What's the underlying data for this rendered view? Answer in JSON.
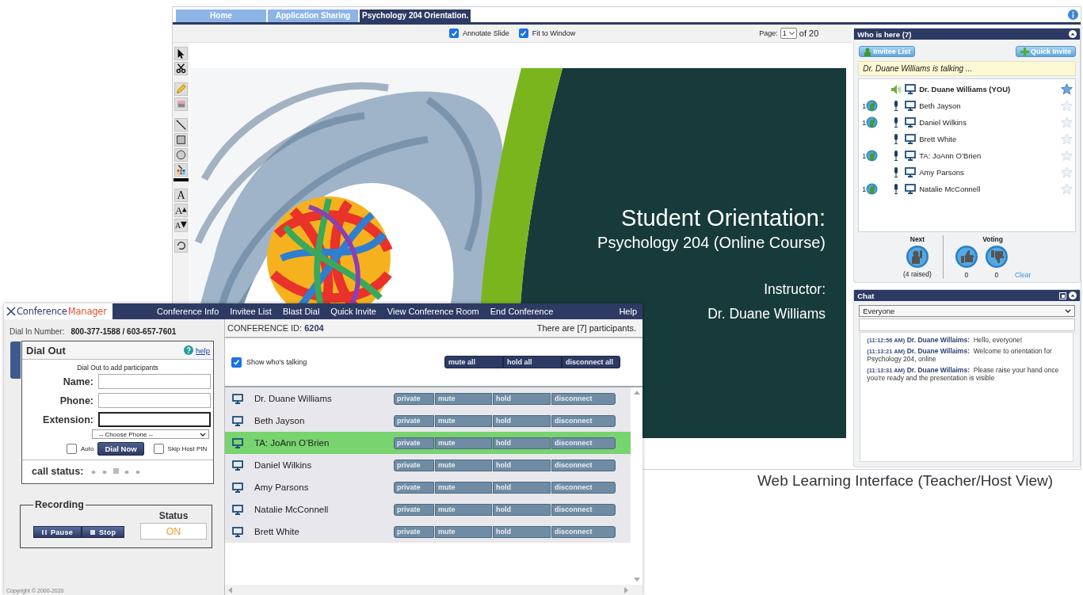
{
  "learning_window": {
    "tabs": [
      {
        "label": "Home",
        "selected": false
      },
      {
        "label": "Application Sharing",
        "selected": false
      },
      {
        "label": "Psychology 204 Orientation.",
        "selected": true
      }
    ],
    "options": [
      {
        "label": "Annotate Slide",
        "checked": true
      },
      {
        "label": "Fit to Window",
        "checked": true
      }
    ],
    "page": {
      "label": "Page:",
      "value": "1",
      "total": "of 20"
    },
    "tools": [
      {
        "kind": "pointer"
      },
      {
        "kind": "scissors"
      },
      {
        "kind": "pencil"
      },
      {
        "kind": "eraser"
      },
      {
        "kind": "line"
      },
      {
        "kind": "rectangle"
      },
      {
        "kind": "ellipse"
      },
      {
        "kind": "color"
      },
      {
        "kind": "text",
        "glyph": "A"
      },
      {
        "kind": "text-larger",
        "glyph": "A"
      },
      {
        "kind": "text-smaller",
        "glyph": "A"
      },
      {
        "kind": "rotate"
      }
    ],
    "slide": {
      "title": "Student Orientation:",
      "subtitle": "Psychology 204 (Online Course)",
      "instructor_label": "Instructor:",
      "instructor_name": "Dr. Duane Williams"
    },
    "who_is_here": {
      "title": "Who is here (7)",
      "buttons": [
        {
          "kind": "invitees",
          "label": "Invitee List"
        },
        {
          "kind": "invite",
          "label": "Quick Invite"
        }
      ],
      "talking": "Dr. Duane Williams is talking ...",
      "participants": [
        {
          "name": "Dr. Duane Williams (YOU)",
          "is_self": true,
          "speaking": true,
          "hand_raised": false,
          "starred": true
        },
        {
          "name": "Beth Jayson",
          "is_self": false,
          "speaking": false,
          "hand_raised": true,
          "hand_count": "1",
          "starred": false
        },
        {
          "name": "Daniel Wilkins",
          "is_self": false,
          "speaking": false,
          "hand_raised": true,
          "hand_count": "1",
          "starred": false
        },
        {
          "name": "Brett White",
          "is_self": false,
          "speaking": false,
          "hand_raised": false,
          "starred": false
        },
        {
          "name": "TA: JoAnn O’Brien",
          "is_self": false,
          "speaking": false,
          "hand_raised": true,
          "hand_count": "1",
          "starred": false
        },
        {
          "name": "Amy Parsons",
          "is_self": false,
          "speaking": false,
          "hand_raised": false,
          "starred": false
        },
        {
          "name": "Natalie McConnell",
          "is_self": false,
          "speaking": false,
          "hand_raised": true,
          "hand_count": "1",
          "starred": false
        }
      ],
      "next": {
        "label": "Next",
        "raised": "(4 raised)"
      },
      "voting": {
        "label": "Voting",
        "yes": "0",
        "no": "0",
        "clear": "Clear"
      }
    },
    "chat": {
      "title": "Chat",
      "recipient": "Everyone",
      "messages": [
        {
          "time": "(11:12:56 AM)",
          "sender": "Dr. Duane Willaims:",
          "text": "Hello, everyone!"
        },
        {
          "time": "(11:13:21 AM)",
          "sender": "Dr. Duane Willaims:",
          "text": "Welcome to orientation for Psychology 204, online"
        },
        {
          "time": "(11:13:31 AM)",
          "sender": "Dr. Duane Willaims:",
          "text": "Please raise your hand once you’re ready and the presentation is visible"
        }
      ]
    }
  },
  "conference_window": {
    "logo": {
      "first": "Conference",
      "second": "Manager"
    },
    "menu": [
      "Conference Info",
      "Invitee List",
      "Blast Dial",
      "Quick Invite",
      "View Conference Room",
      "End Conference",
      "Help"
    ],
    "dial_in": {
      "label": "Dial In Number:",
      "value": "800-377-1588 / 603-657-7601"
    },
    "dial_out": {
      "title": "Dial Out",
      "help": "help",
      "hint": "Dial Out to add participants",
      "fields": [
        {
          "label": "Name:",
          "focused": false
        },
        {
          "label": "Phone:",
          "focused": false
        },
        {
          "label": "Extension:",
          "focused": true
        }
      ],
      "phone_select": "-- Choose Phone --",
      "auto": {
        "label": "Auto",
        "checked": false
      },
      "dial_button": "Dial Now",
      "skip_pin": {
        "label": "Skip Host PIN",
        "checked": false
      },
      "call_status": "call status:"
    },
    "recording": {
      "title": "Recording",
      "buttons": [
        {
          "kind": "pause",
          "label": "Pause"
        },
        {
          "kind": "stop",
          "label": "Stop"
        }
      ],
      "status_label": "Status",
      "status": "ON"
    },
    "copyright": "Copyright © 2000-2020",
    "conference_id": {
      "label": "CONFERENCE ID:",
      "value": "6204"
    },
    "participant_count": "There are [7] participants.",
    "show_talking": {
      "label": "Show who's talking",
      "checked": true
    },
    "bulk_actions": [
      "mute all",
      "hold all",
      "disconnect all"
    ],
    "participants": [
      {
        "name": "Dr. Duane Williams",
        "talking": false,
        "actions": [
          "private",
          "mute",
          "hold",
          "disconnect"
        ]
      },
      {
        "name": "Beth Jayson",
        "talking": false,
        "actions": [
          "private",
          "mute",
          "hold",
          "disconnect"
        ]
      },
      {
        "name": "TA: JoAnn O’Brien",
        "talking": true,
        "actions": [
          "private",
          "mute",
          "hold",
          "disconnect"
        ]
      },
      {
        "name": "Daniel Wilkins",
        "talking": false,
        "actions": [
          "private",
          "mute",
          "hold",
          "disconnect"
        ]
      },
      {
        "name": "Amy Parsons",
        "talking": false,
        "actions": [
          "private",
          "mute",
          "hold",
          "disconnect"
        ]
      },
      {
        "name": "Natalie McConnell",
        "talking": false,
        "actions": [
          "private",
          "mute",
          "hold",
          "disconnect"
        ]
      },
      {
        "name": "Brett White",
        "talking": false,
        "actions": [
          "private",
          "mute",
          "hold",
          "disconnect"
        ]
      }
    ]
  },
  "caption": "Web Learning Interface (Teacher/Host View)"
}
